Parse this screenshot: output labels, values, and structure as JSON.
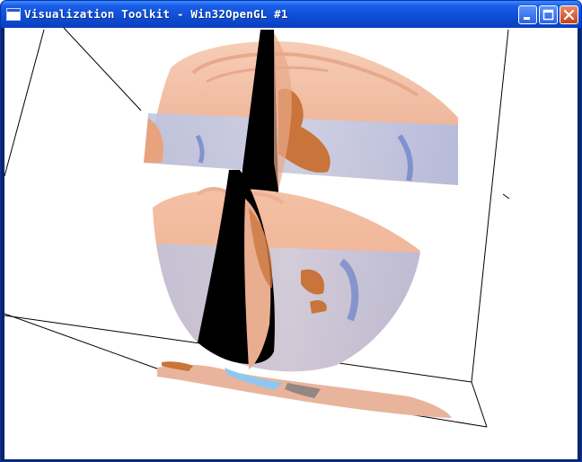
{
  "window": {
    "title": "Visualization Toolkit - Win32OpenGL #1",
    "app_icon": "vtk-window-icon",
    "controls": {
      "minimize": "minimize-icon",
      "maximize": "maximize-icon",
      "close": "close-icon"
    }
  },
  "scene": {
    "background": "#ffffff",
    "outline_color": "#000000",
    "skin_color": "#f2b89c",
    "tissue_color": "#c8743a",
    "slice_tint": "#9fb7e6",
    "cut_plane_color": "#000000",
    "floor_highlight": "#8ec8f0"
  }
}
